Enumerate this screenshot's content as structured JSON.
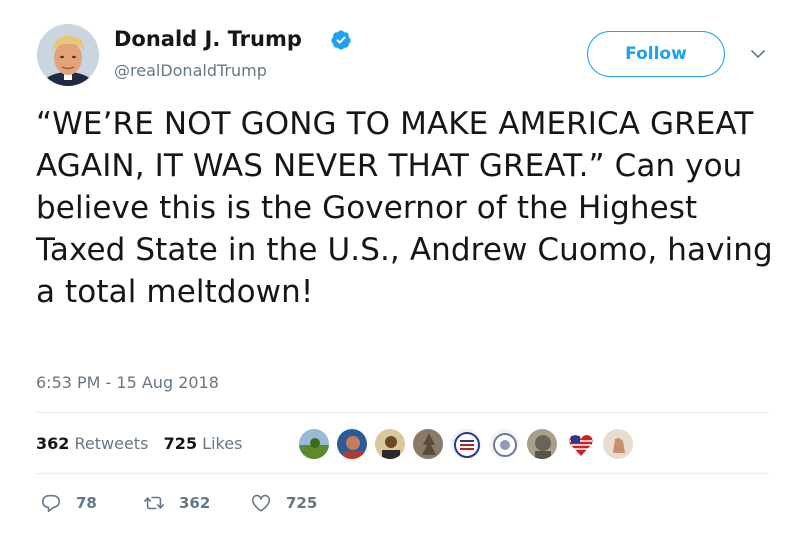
{
  "author": {
    "name": "Donald J. Trump",
    "handle": "@realDonaldTrump",
    "verified": true
  },
  "follow_button": {
    "label": "Follow"
  },
  "tweet": {
    "text": "“WE’RE NOT GONG TO MAKE AMERICA GREAT AGAIN, IT WAS NEVER THAT GREAT.”  Can you believe this is the Governor of the Highest Taxed State in the U.S., Andrew Cuomo, having a total meltdown!",
    "timestamp": "6:53 PM - 15 Aug 2018"
  },
  "stats": {
    "retweets_count": "362",
    "retweets_label": "Retweets",
    "likes_count": "725",
    "likes_label": "Likes"
  },
  "likers": [
    "grass-photo-avatar",
    "person-avatar",
    "person-avatar",
    "tree-avatar",
    "usa-badge-avatar",
    "globe-badge-avatar",
    "statue-avatar",
    "heart-flag-avatar",
    "hand-avatar"
  ],
  "actions": {
    "reply_count": "78",
    "retweet_count": "362",
    "like_count": "725"
  },
  "colors": {
    "accent": "#1da1f2",
    "secondary_text": "#657786",
    "text": "#14171a"
  }
}
